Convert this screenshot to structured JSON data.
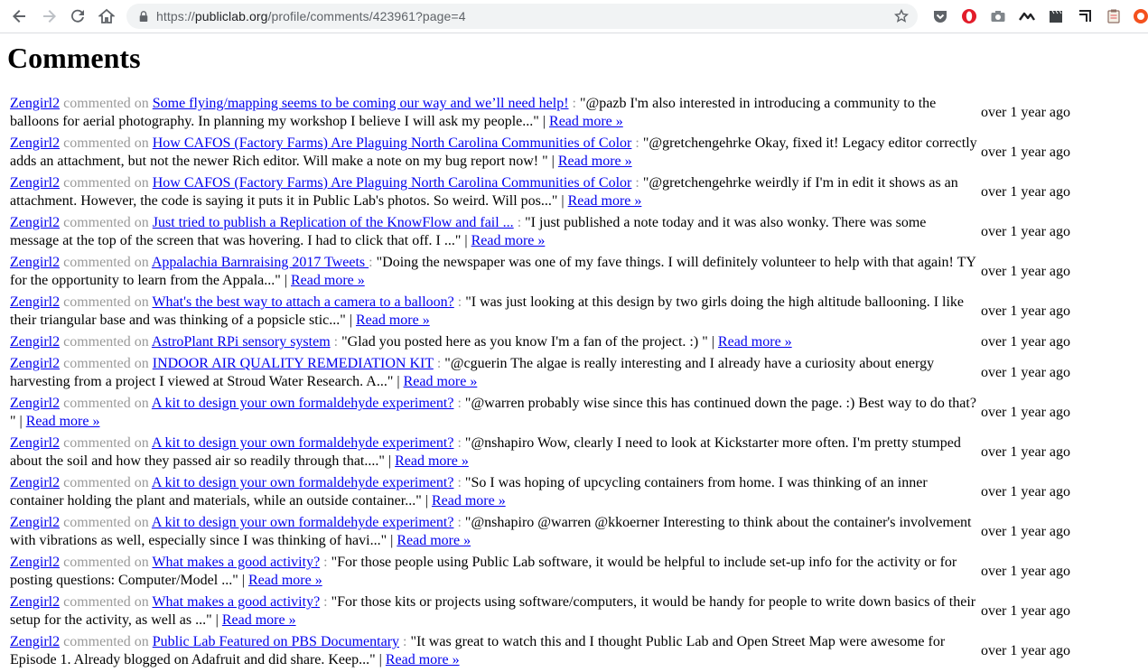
{
  "browser": {
    "url_scheme": "https://",
    "url_host": "publiclab.org",
    "url_path": "/profile/comments/423961?page=4"
  },
  "page": {
    "title": "Comments"
  },
  "labels": {
    "commented_on": "commented on",
    "sep": ":",
    "read_more": "Read »"
  },
  "comments": [
    {
      "author": "Zengirl2",
      "node": "Some flying/mapping seems to be coming our way and we’ll need help!",
      "excerpt": "\"@pazb I'm also interested in introducing a community to the balloons for aerial photography. In planning my workshop I believe I will ask my people...\" |",
      "read_more": "Read more »",
      "time": "over 1 year ago"
    },
    {
      "author": "Zengirl2",
      "node": "How CAFOS (Factory Farms) Are Plaguing North Carolina Communities of Color",
      "excerpt": "\"@gretchengehrke Okay, fixed it! Legacy editor correctly adds an attachment, but not the newer Rich editor. Will make a note on my bug report now! \" |",
      "read_more": "Read more »",
      "time": "over 1 year ago"
    },
    {
      "author": "Zengirl2",
      "node": "How CAFOS (Factory Farms) Are Plaguing North Carolina Communities of Color",
      "excerpt": "\"@gretchengehrke weirdly if I'm in edit it shows as an attachment. However, the code is saying it puts it in Public Lab's photos. So weird. Will pos...\" |",
      "read_more": "Read more »",
      "time": "over 1 year ago"
    },
    {
      "author": "Zengirl2",
      "node": "Just tried to publish a Replication of the KnowFlow and fail ...",
      "excerpt": "\"I just published a note today and it was also wonky. There was some message at the top of the screen that was hovering. I had to click that off. I ...\" |",
      "read_more": "Read more »",
      "time": "over 1 year ago"
    },
    {
      "author": "Zengirl2",
      "node": "Appalachia Barnraising 2017 Tweets ",
      "excerpt": "\"Doing the newspaper was one of my fave things. I will definitely volunteer to help with that again! TY for the opportunity to learn from the Appala...\" |",
      "read_more": "Read more »",
      "time": "over 1 year ago"
    },
    {
      "author": "Zengirl2",
      "node": "What's the best way to attach a camera to a balloon?",
      "excerpt": "\"I was just looking at this design by two girls doing the high altitude ballooning. I like their triangular base and was thinking of a popsicle stic...\" |",
      "read_more": "Read more »",
      "time": "over 1 year ago"
    },
    {
      "author": "Zengirl2",
      "node": "AstroPlant RPi sensory system",
      "excerpt": "\"Glad you posted here as you know I'm a fan of the project. :) \" |",
      "read_more": "Read more »",
      "time": "over 1 year ago"
    },
    {
      "author": "Zengirl2",
      "node": "INDOOR AIR QUALITY REMEDIATION KIT",
      "excerpt": "\"@cguerin The algae is really interesting and I already have a curiosity about energy harvesting from a project I viewed at Stroud Water Research. A...\" |",
      "read_more": "Read more »",
      "time": "over 1 year ago"
    },
    {
      "author": "Zengirl2",
      "node": "A kit to design your own formaldehyde experiment?",
      "excerpt": "\"@warren probably wise since this has continued down the page. :) Best way to do that? \" |",
      "read_more": "Read more »",
      "time": "over 1 year ago"
    },
    {
      "author": "Zengirl2",
      "node": "A kit to design your own formaldehyde experiment?",
      "excerpt": "\"@nshapiro Wow, clearly I need to look at Kickstarter more often. I'm pretty stumped about the soil and how they passed air so readily through that....\" |",
      "read_more": "Read more »",
      "time": "over 1 year ago"
    },
    {
      "author": "Zengirl2",
      "node": "A kit to design your own formaldehyde experiment?",
      "excerpt": "\"So I was hoping of upcycling containers from home. I was thinking of an inner container holding the plant and materials, while an outside container...\" |",
      "read_more": "Read more »",
      "time": "over 1 year ago"
    },
    {
      "author": "Zengirl2",
      "node": "A kit to design your own formaldehyde experiment?",
      "excerpt": "\"@nshapiro @warren @kkoerner Interesting to think about the container's involvement with vibrations as well, especially since I was thinking of havi...\" |",
      "read_more": "Read more »",
      "time": "over 1 year ago"
    },
    {
      "author": "Zengirl2",
      "node": "What makes a good activity?",
      "excerpt": "\"For those people using Public Lab software, it would be helpful to include set-up info for the activity or for posting questions: Computer/Model ...\" |",
      "read_more": "Read more »",
      "time": "over 1 year ago"
    },
    {
      "author": "Zengirl2",
      "node": "What makes a good activity?",
      "excerpt": "\"For those kits or projects using software/computers, it would be handy for people to write down basics of their setup for the activity, as well as ...\" |",
      "read_more": "Read more »",
      "time": "over 1 year ago"
    },
    {
      "author": "Zengirl2",
      "node": "Public Lab Featured on PBS Documentary",
      "excerpt": "\"It was great to watch this and I thought Public Lab and Open Street Map were awesome for Episode 1. Already blogged on Adafruit and did share. Keep...\" |",
      "read_more": "Read more »",
      "time": "over 1 year ago"
    }
  ]
}
